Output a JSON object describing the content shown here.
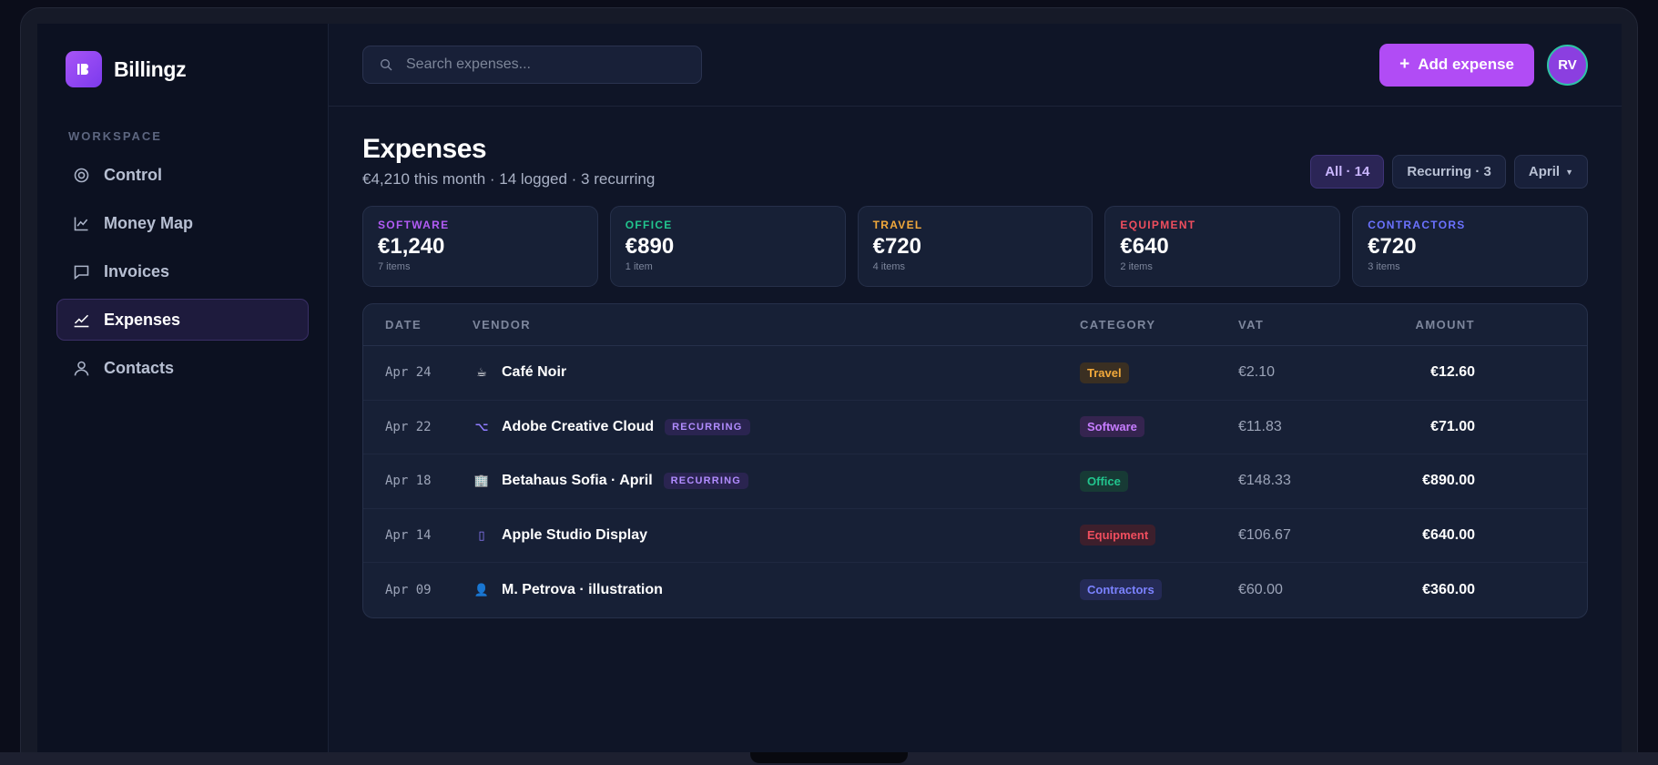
{
  "app": {
    "name": "Billingz",
    "logo_icon": "logo-mark-icon",
    "accent": "#b14cf5"
  },
  "sidebar": {
    "section_label": "WORKSPACE",
    "items": [
      {
        "label": "Control",
        "icon": "target-icon",
        "active": false
      },
      {
        "label": "Money Map",
        "icon": "line-chart-icon",
        "active": false
      },
      {
        "label": "Invoices",
        "icon": "message-square-icon",
        "active": false
      },
      {
        "label": "Expenses",
        "icon": "trend-check-icon",
        "active": true
      },
      {
        "label": "Contacts",
        "icon": "user-icon",
        "active": false
      }
    ]
  },
  "topbar": {
    "search_placeholder": "Search expenses...",
    "add_button_label": "Add expense",
    "add_button_icon": "+",
    "avatar_initials": "RV"
  },
  "page": {
    "title": "Expenses",
    "subtitle": "€4,210 this month · 14 logged · 3 recurring",
    "filters": [
      {
        "label": "All · 14",
        "active": true
      },
      {
        "label": "Recurring · 3",
        "active": false
      },
      {
        "label": "April",
        "active": false,
        "dropdown": true
      }
    ]
  },
  "summary_cards": [
    {
      "label": "SOFTWARE",
      "value": "€1,240",
      "count": "7 items",
      "color": "#b35cf6"
    },
    {
      "label": "OFFICE",
      "value": "€890",
      "count": "1 item",
      "color": "#22c58e"
    },
    {
      "label": "TRAVEL",
      "value": "€720",
      "count": "4 items",
      "color": "#f2a93b"
    },
    {
      "label": "EQUIPMENT",
      "value": "€640",
      "count": "2 items",
      "color": "#f04e5e"
    },
    {
      "label": "CONTRACTORS",
      "value": "€720",
      "count": "3 items",
      "color": "#6b72ff"
    }
  ],
  "table": {
    "columns": [
      "DATE",
      "VENDOR",
      "CATEGORY",
      "VAT",
      "AMOUNT"
    ],
    "recurring_label": "RECURRING",
    "rows": [
      {
        "date": "Apr 24",
        "vendor": "Café Noir",
        "icon": "coffee-icon",
        "glyph": "☕",
        "recurring": false,
        "category": "Travel",
        "cat_color": "#f2a93b",
        "cat_bg": "#3a2f22",
        "vat": "€2.10",
        "amount": "€12.60"
      },
      {
        "date": "Apr 22",
        "vendor": "Adobe Creative Cloud",
        "icon": "option-key-icon",
        "glyph": "⌥",
        "recurring": true,
        "category": "Software",
        "cat_color": "#c77dff",
        "cat_bg": "#35244f",
        "vat": "€11.83",
        "amount": "€71.00"
      },
      {
        "date": "Apr 18",
        "vendor": "Betahaus Sofia · April",
        "icon": "building-icon",
        "glyph": "🏢",
        "recurring": true,
        "category": "Office",
        "cat_color": "#22c58e",
        "cat_bg": "#173a35",
        "vat": "€148.33",
        "amount": "€890.00"
      },
      {
        "date": "Apr 14",
        "vendor": "Apple Studio Display",
        "icon": "display-icon",
        "glyph": "▯",
        "recurring": false,
        "category": "Equipment",
        "cat_color": "#f04e5e",
        "cat_bg": "#3d1f2c",
        "vat": "€106.67",
        "amount": "€640.00"
      },
      {
        "date": "Apr 09",
        "vendor": "M. Petrova · illustration",
        "icon": "person-icon",
        "glyph": "👤",
        "recurring": false,
        "category": "Contractors",
        "cat_color": "#7b82ff",
        "cat_bg": "#242a55",
        "vat": "€60.00",
        "amount": "€360.00"
      }
    ]
  }
}
